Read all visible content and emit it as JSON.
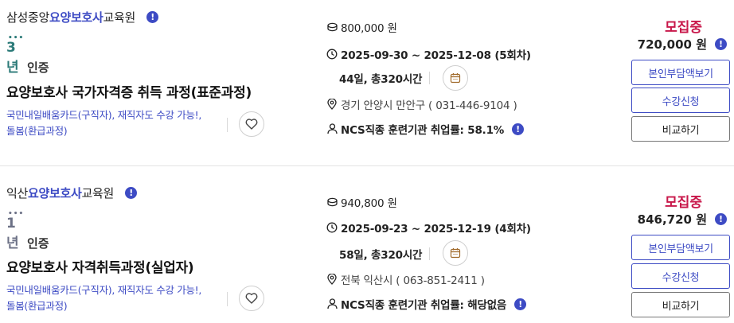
{
  "courses": [
    {
      "institution_pre": "삼성중앙",
      "institution_hl": "요양보호사",
      "institution_post": "교육원",
      "cert_years": "3년",
      "cert_label": "인증",
      "title": "요양보호사 국가자격증 취득 과정(표준과정)",
      "tags": [
        "국민내일배움카드(구직자),",
        "재직자도 수강 가능!,",
        "돌봄(환급과정)"
      ],
      "original_price": "800,000 원",
      "dates": "2025-09-30 ~ 2025-12-08 (5회차)",
      "duration": "44일, 총320시간",
      "address": "경기 안양시 만안구 ( 031-446-9104 )",
      "ncs": "NCS직종 훈련기관 취업률: 58.1%",
      "status": "모집중",
      "price": "720,000 원",
      "btn_selfpay": "본인부담액보기",
      "btn_apply": "수강신청",
      "btn_compare": "비교하기"
    },
    {
      "institution_pre": "익산",
      "institution_hl": "요양보호사",
      "institution_post": "교육원",
      "cert_years": "1년",
      "cert_label": "인증",
      "title": "요양보호사 자격취득과정(실업자)",
      "tags": [
        "국민내일배움카드(구직자),",
        "재직자도 수강 가능!,",
        "돌봄(환급과정)"
      ],
      "original_price": "940,800 원",
      "dates": "2025-09-23 ~ 2025-12-19 (4회차)",
      "duration": "58일, 총320시간",
      "address": "전북 익산시 ( 063-851-2411 )",
      "ncs": "NCS직종 훈련기관 취업률: 해당없음",
      "status": "모집중",
      "price": "846,720 원",
      "btn_selfpay": "본인부담액보기",
      "btn_apply": "수강신청",
      "btn_compare": "비교하기"
    }
  ],
  "colors": {
    "accent": "#3d4bc4",
    "status": "#c8174a",
    "cert_teal": "#2b7a78"
  },
  "icons": [
    "info-icon",
    "coin-icon",
    "clock-icon",
    "calendar-icon",
    "location-icon",
    "person-icon",
    "heart-icon"
  ]
}
